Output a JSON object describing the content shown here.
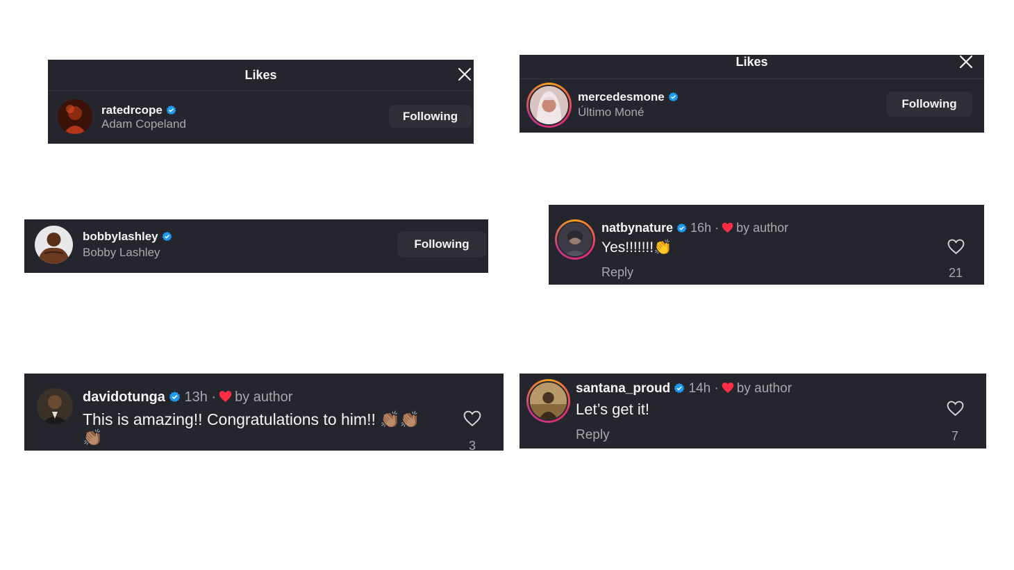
{
  "likes_left": {
    "title": "Likes",
    "user": {
      "username": "ratedrcope",
      "full_name": "Adam Copeland",
      "button": "Following"
    }
  },
  "likes_right": {
    "title": "Likes",
    "user": {
      "username": "mercedesmone",
      "full_name": "Último Moné",
      "button": "Following"
    }
  },
  "bobby": {
    "username": "bobbylashley",
    "full_name": "Bobby Lashley",
    "button": "Following"
  },
  "comment_nat": {
    "username": "natbynature",
    "time": "16h",
    "separator": "·",
    "liked_by": "by author",
    "text": "Yes!!!!!!!👏",
    "reply": "Reply",
    "likes": "21"
  },
  "comment_david": {
    "username": "davidotunga",
    "time": "13h",
    "separator": "·",
    "liked_by": "by author",
    "text_line1": "This is amazing!! Congratulations to him!! 👏🏽👏🏽",
    "text_line2": "👏🏽",
    "likes": "3"
  },
  "comment_santana": {
    "username": "santana_proud",
    "time": "14h",
    "separator": "·",
    "liked_by": "by author",
    "text": "Let’s get it!",
    "reply": "Reply",
    "likes": "7"
  },
  "colors": {
    "panel": "#25262d",
    "verified": "#1d9bf0",
    "heart": "#ff2d43",
    "muted": "#a8a9ae"
  },
  "icons": {
    "close": "close-icon",
    "verified": "verified-badge-icon",
    "like": "heart-outline-icon",
    "liked_by_author": "red-heart-icon"
  }
}
